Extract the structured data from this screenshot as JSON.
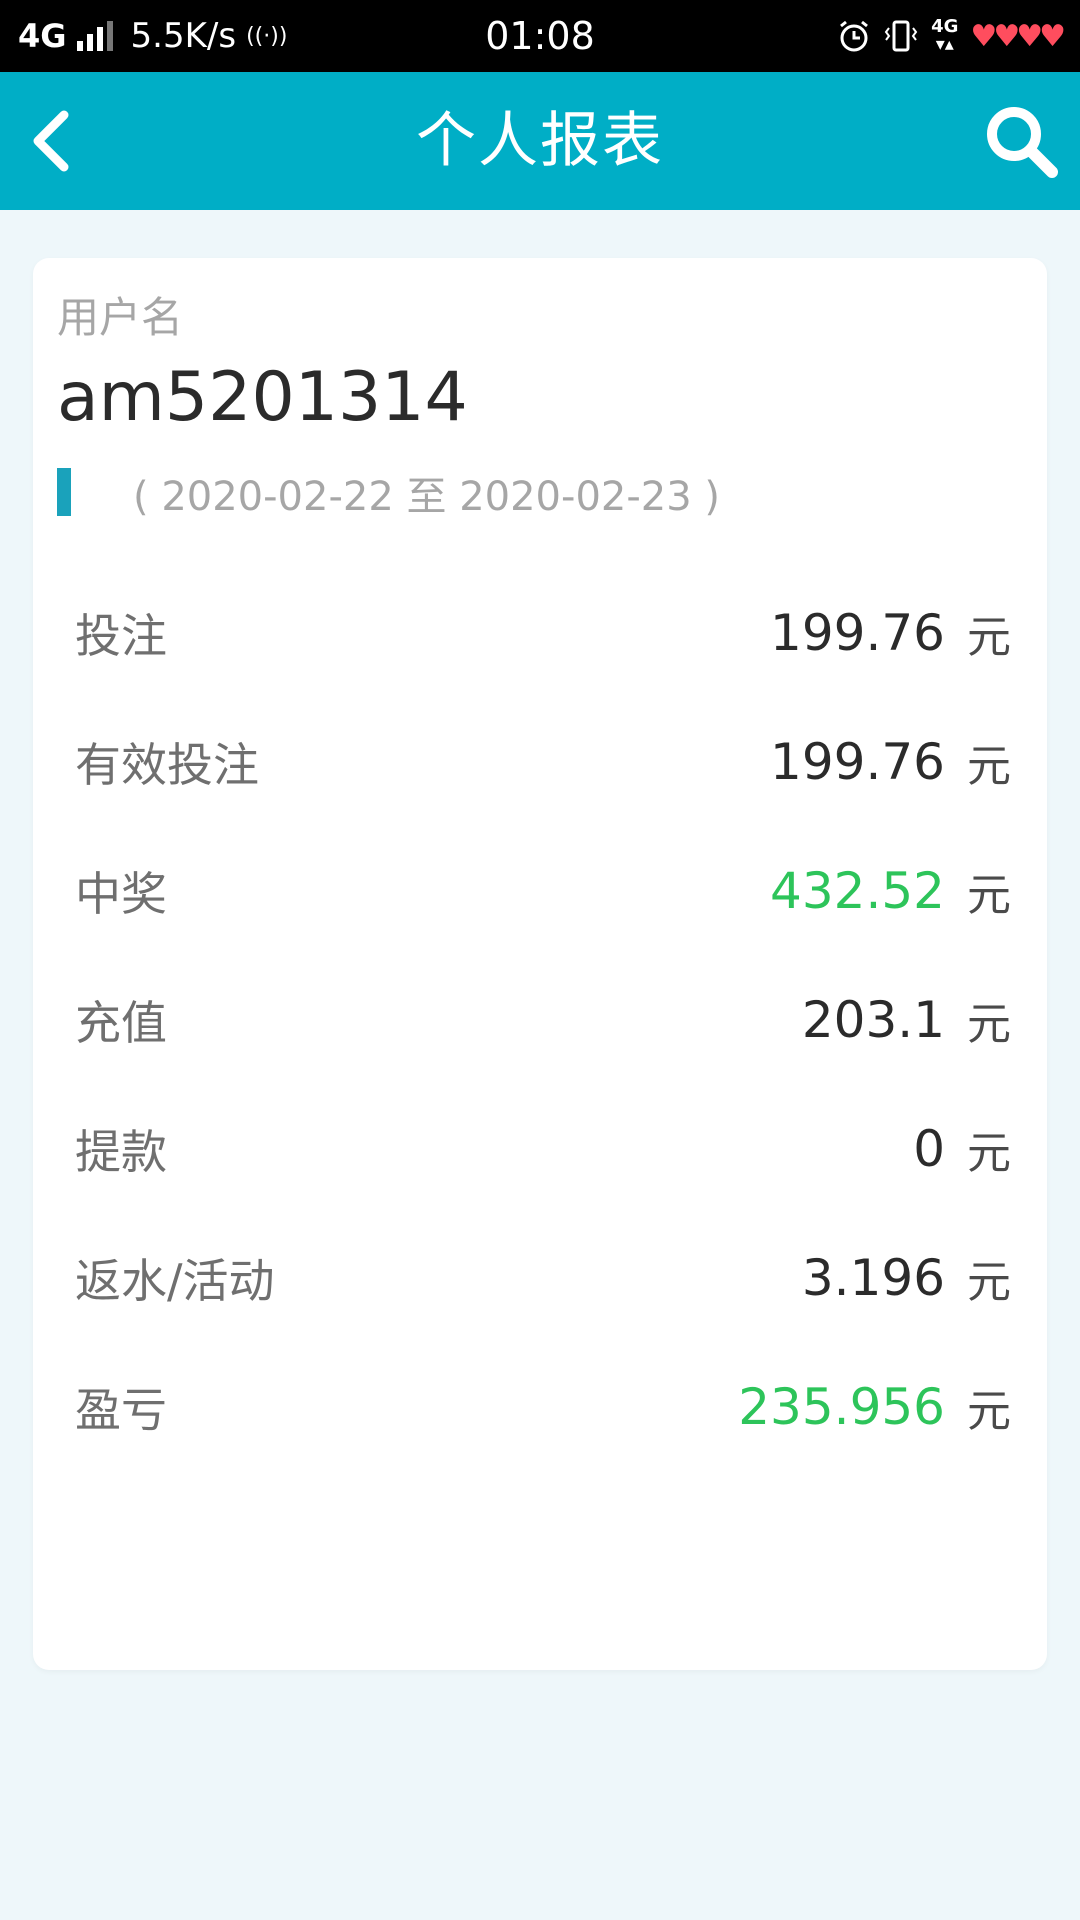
{
  "status_bar": {
    "network": "4G",
    "speed": "5.5K/s",
    "time": "01:08",
    "network_small": "4G"
  },
  "header": {
    "title": "个人报表"
  },
  "card": {
    "username_label": "用户名",
    "username": "am5201314",
    "date_range": "( 2020-02-22 至 2020-02-23 )",
    "stats": [
      {
        "label": "投注",
        "value": "199.76",
        "unit": "元"
      },
      {
        "label": "有效投注",
        "value": "199.76",
        "unit": "元"
      },
      {
        "label": "中奖",
        "value": "432.52",
        "unit": "元"
      },
      {
        "label": "充值",
        "value": "203.1",
        "unit": "元"
      },
      {
        "label": "提款",
        "value": "0",
        "unit": "元"
      },
      {
        "label": "返水/活动",
        "value": "3.196",
        "unit": "元"
      },
      {
        "label": "盈亏",
        "value": "235.956",
        "unit": "元"
      }
    ]
  },
  "colors": {
    "header_bg": "#00aec6",
    "positive": "#2dc45a",
    "accent_marker": "#1aa2bb"
  }
}
